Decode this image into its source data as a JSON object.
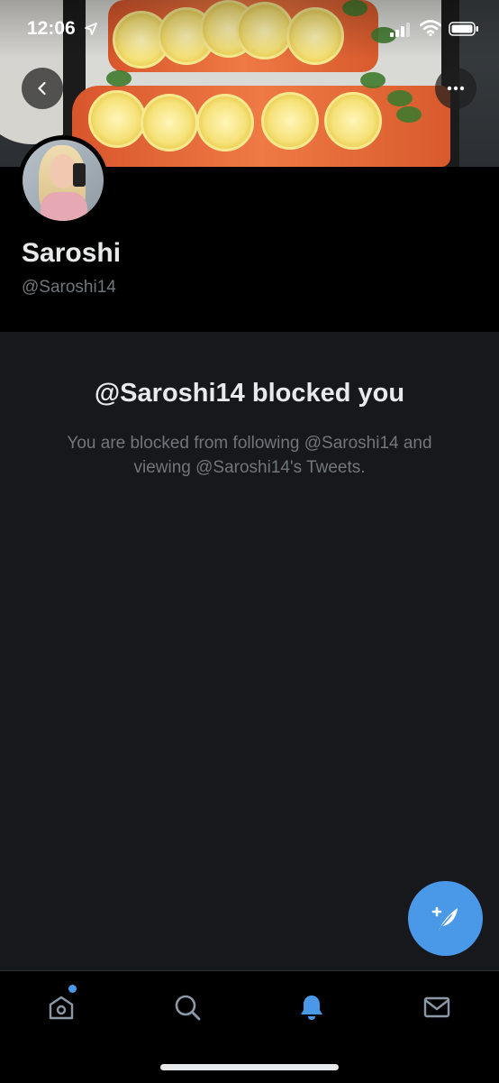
{
  "status_bar": {
    "time": "12:06"
  },
  "profile": {
    "display_name": "Saroshi",
    "handle": "@Saroshi14"
  },
  "blocked": {
    "title": "@Saroshi14 blocked you",
    "description": "You are blocked from following @Saroshi14 and viewing @Saroshi14's Tweets."
  },
  "icons": {
    "back": "chevron-left-icon",
    "more": "more-horizontal-icon",
    "compose": "compose-tweet-icon",
    "home": "home-icon",
    "search": "search-icon",
    "notifications": "bell-icon",
    "messages": "mail-icon"
  },
  "colors": {
    "accent": "#4a99e9",
    "background": "#16181c",
    "header_background": "#000000",
    "secondary_text": "#71767b"
  },
  "tabbar": {
    "active_tab": "notifications",
    "home_has_new": true
  }
}
